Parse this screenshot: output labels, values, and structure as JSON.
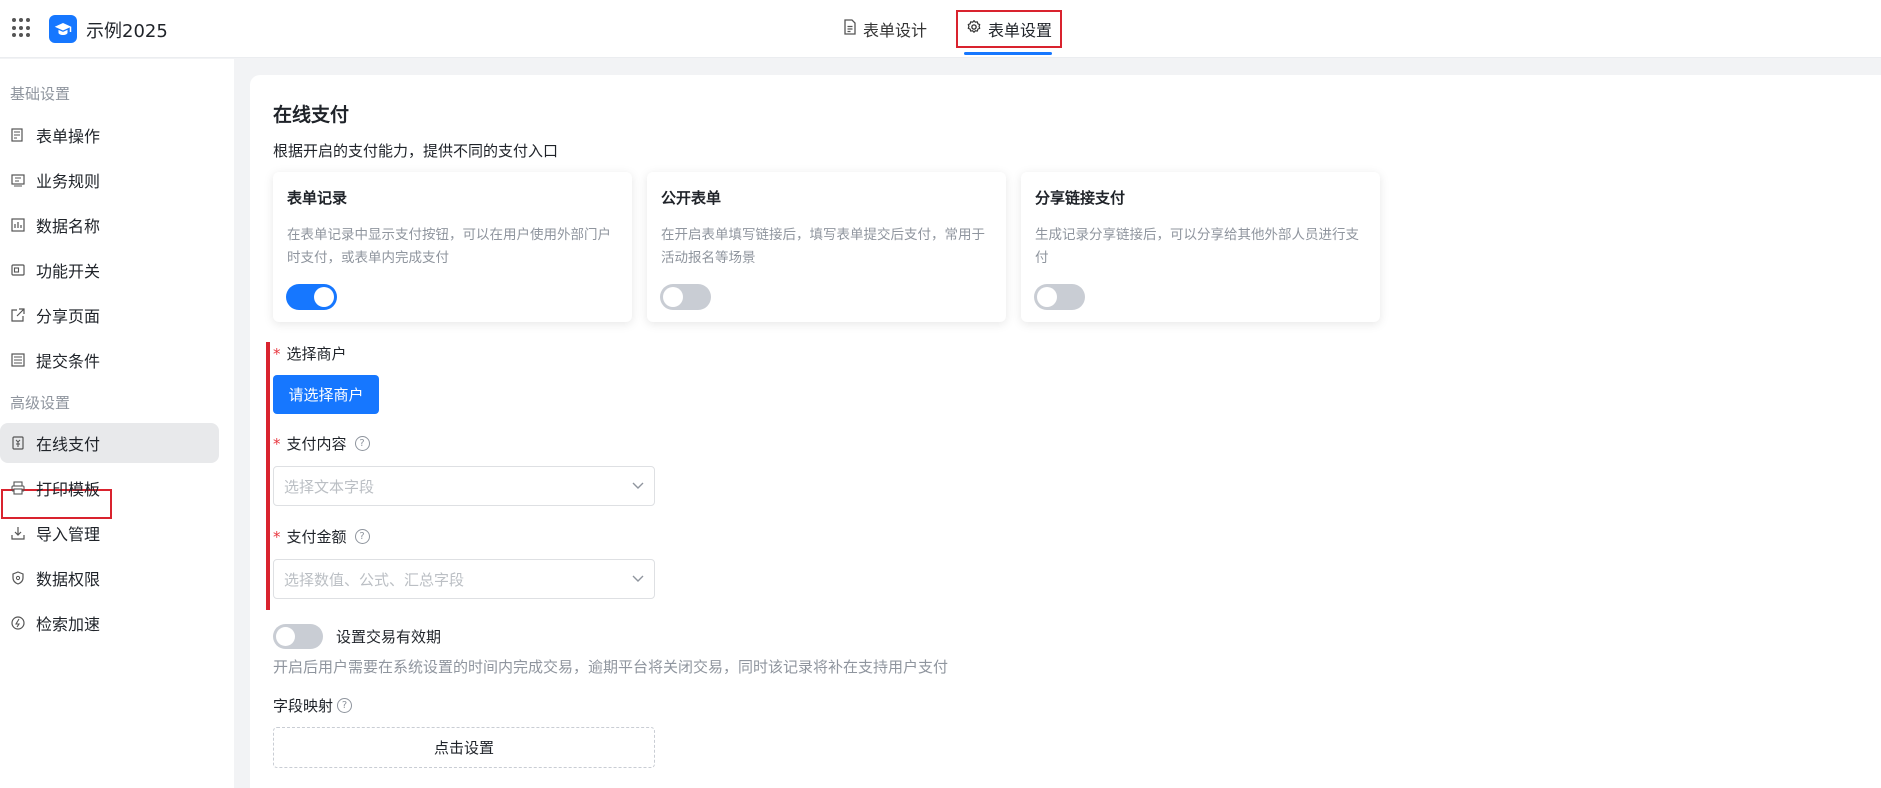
{
  "app": {
    "title": "示例2025"
  },
  "tabs": [
    {
      "label": "表单设计",
      "icon": "document-icon"
    },
    {
      "label": "表单设置",
      "icon": "gear-icon",
      "active": true
    }
  ],
  "sidebar": {
    "sections": [
      "基础设置",
      "高级设置"
    ],
    "basic_items": [
      {
        "label": "表单操作",
        "icon": "form-action-icon"
      },
      {
        "label": "业务规则",
        "icon": "rule-icon"
      },
      {
        "label": "数据名称",
        "icon": "data-name-icon"
      },
      {
        "label": "功能开关",
        "icon": "switch-icon"
      },
      {
        "label": "分享页面",
        "icon": "share-icon"
      },
      {
        "label": "提交条件",
        "icon": "list-icon"
      }
    ],
    "advanced_items": [
      {
        "label": "在线支付",
        "icon": "payment-icon",
        "active": true
      },
      {
        "label": "打印模板",
        "icon": "printer-icon"
      },
      {
        "label": "导入管理",
        "icon": "import-icon"
      },
      {
        "label": "数据权限",
        "icon": "shield-icon"
      },
      {
        "label": "检索加速",
        "icon": "speed-icon"
      }
    ]
  },
  "main": {
    "title": "在线支付",
    "description": "根据开启的支付能力，提供不同的支付入口",
    "cards": [
      {
        "title": "表单记录",
        "desc": "在表单记录中显示支付按钮，可以在用户使用外部门户时支付，或表单内完成支付",
        "enabled": true
      },
      {
        "title": "公开表单",
        "desc": "在开启表单填写链接后，填写表单提交后支付，常用于活动报名等场景",
        "enabled": false
      },
      {
        "title": "分享链接支付",
        "desc": "生成记录分享链接后，可以分享给其他外部人员进行支付",
        "enabled": false
      }
    ],
    "merchant": {
      "label": "选择商户",
      "required_mark": "*",
      "button": "请选择商户"
    },
    "content": {
      "label": "支付内容",
      "required_mark": "*",
      "placeholder": "选择文本字段"
    },
    "amount": {
      "label": "支付金额",
      "required_mark": "*",
      "placeholder": "选择数值、公式、汇总字段"
    },
    "expire": {
      "label": "设置交易有效期",
      "enabled": false,
      "desc": "开启后用户需要在系统设置的时间内完成交易，逾期平台将关闭交易，同时该记录将补在支持用户支付"
    },
    "mapping": {
      "label": "字段映射",
      "button": "点击设置"
    }
  },
  "colors": {
    "accent": "#1677ff",
    "highlight_border": "#d9232e",
    "required": "#e8373f"
  }
}
